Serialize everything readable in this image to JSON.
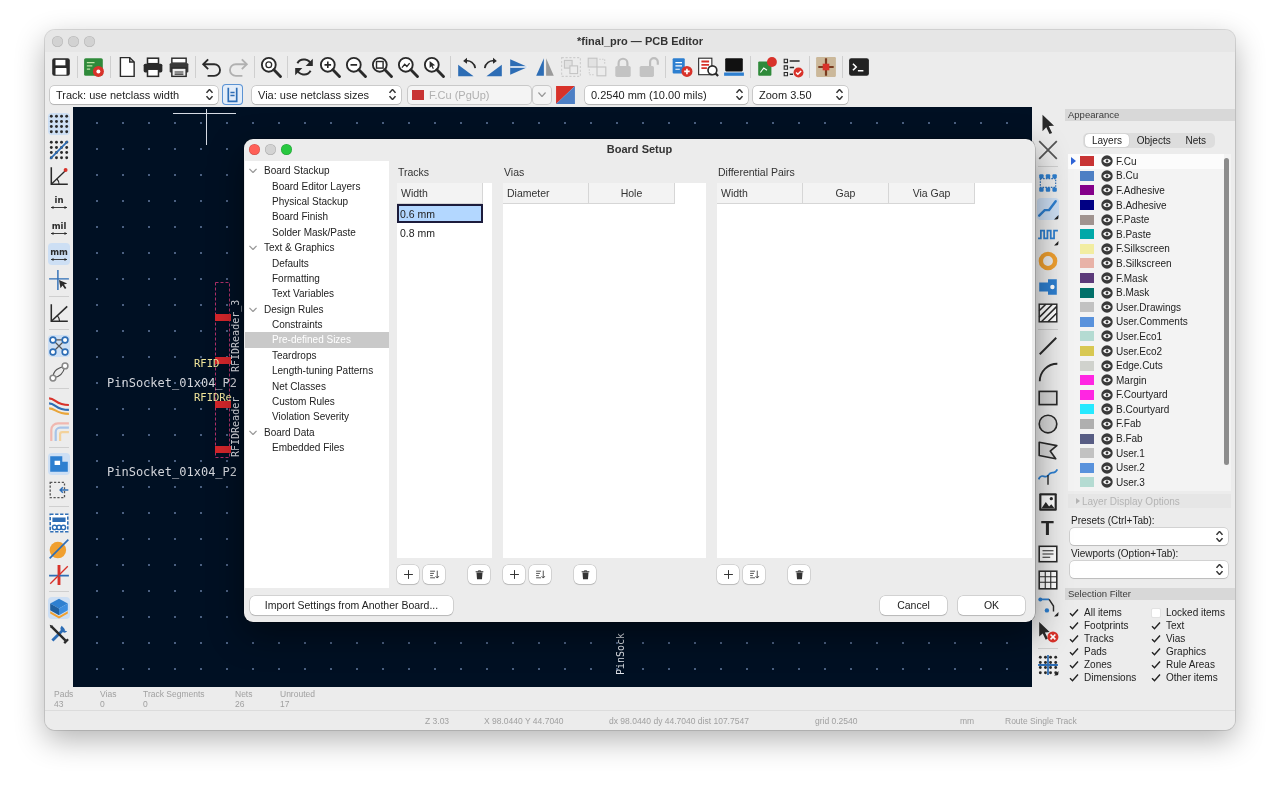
{
  "window": {
    "title": "*final_pro — PCB Editor"
  },
  "top_toolbar": [
    {
      "disabled": false
    },
    {
      "disabled": false
    },
    {
      "disabled": false
    },
    {
      "disabled": false
    },
    {
      "disabled": false
    },
    {
      "disabled": false
    },
    {
      "disabled": true
    },
    {
      "disabled": false
    },
    {
      "disabled": false
    },
    {
      "disabled": false
    },
    {
      "disabled": false
    },
    {
      "disabled": false
    },
    {
      "disabled": false
    },
    {
      "disabled": false
    },
    {
      "disabled": false
    },
    {
      "disabled": false
    },
    {
      "disabled": false
    },
    {
      "disabled": false
    },
    {
      "disabled": true
    },
    {
      "disabled": true
    },
    {
      "disabled": true
    },
    {
      "disabled": true
    },
    {
      "disabled": false
    },
    {
      "disabled": false
    },
    {
      "disabled": false
    },
    {
      "disabled": false
    },
    {
      "disabled": false
    },
    {
      "disabled": false
    },
    {
      "disabled": false
    }
  ],
  "options_bar": {
    "track_width": "Track: use netclass width",
    "width_toggle": {
      "on": true
    },
    "via_size": "Via: use netclass sizes",
    "layer": {
      "label": "F.Cu (PgUp)",
      "disabled": true
    },
    "grid": "0.2540 mm (10.00 mils)",
    "zoom": "Zoom 3.50"
  },
  "left_toolbar": [
    {
      "kind": "tool",
      "on": true
    },
    {
      "kind": "tool",
      "on": false
    },
    {
      "kind": "tool",
      "on": false
    },
    {
      "kind": "unit",
      "label": "in",
      "selected": false
    },
    {
      "kind": "unit",
      "label": "mil",
      "selected": false
    },
    {
      "kind": "unit",
      "label": "mm",
      "selected": true
    },
    {
      "kind": "tool",
      "on": false
    },
    {
      "kind": "tool",
      "on": false
    },
    {
      "kind": "tool",
      "on": true
    },
    {
      "kind": "tool",
      "on": false
    },
    {
      "kind": "tool",
      "on": false
    },
    {
      "kind": "tool",
      "on": false
    },
    {
      "kind": "tool",
      "on": true
    },
    {
      "kind": "tool",
      "on": false
    },
    {
      "kind": "tool",
      "on": false
    },
    {
      "kind": "tool",
      "on": false
    },
    {
      "kind": "tool",
      "on": false
    },
    {
      "kind": "tool",
      "on": true
    },
    {
      "kind": "tool",
      "on": false
    }
  ],
  "canvas": {
    "labels": [
      {
        "kind": "silk",
        "text": "RFID"
      },
      {
        "kind": "fab",
        "text": "PinSocket_01x04_P2"
      },
      {
        "kind": "silk",
        "text": "RFIDRe"
      },
      {
        "kind": "fab",
        "text": "PinSocket_01x04_P2"
      },
      {
        "kind": "rotated",
        "text": "RFIDReader_3"
      },
      {
        "kind": "rotated",
        "text": "RFIDReader"
      },
      {
        "kind": "rotated",
        "text": "PinSock"
      }
    ]
  },
  "right_toolbar": [
    {
      "kind": "tool",
      "on": false
    },
    {
      "kind": "tool",
      "on": false
    },
    {
      "kind": "tool",
      "on": false
    },
    {
      "kind": "tool",
      "on": true
    },
    {
      "kind": "tool",
      "on": false
    },
    {
      "kind": "tool",
      "on": false
    },
    {
      "kind": "tool",
      "on": false
    },
    {
      "kind": "tool",
      "on": false
    },
    {
      "kind": "tool",
      "on": false
    },
    {
      "kind": "tool",
      "on": false
    },
    {
      "kind": "tool",
      "on": false
    },
    {
      "kind": "tool",
      "on": false
    },
    {
      "kind": "tool",
      "on": false
    },
    {
      "kind": "tool",
      "on": false
    },
    {
      "kind": "tool",
      "on": false
    },
    {
      "kind": "glyph",
      "label": "T",
      "on": false
    },
    {
      "kind": "tool",
      "on": false
    },
    {
      "kind": "tool",
      "on": false
    },
    {
      "kind": "tool",
      "on": false
    },
    {
      "kind": "tool",
      "on": false
    },
    {
      "kind": "tool",
      "on": false
    }
  ],
  "appearance": {
    "title": "Appearance",
    "tabs": [
      {
        "label": "Layers",
        "selected": true
      },
      {
        "label": "Objects",
        "selected": false
      },
      {
        "label": "Nets",
        "selected": false
      }
    ],
    "layers": [
      {
        "name": "F.Cu",
        "color": "#c83434",
        "visible": true,
        "selected": true
      },
      {
        "name": "B.Cu",
        "color": "#4d7fc4",
        "visible": true,
        "selected": false
      },
      {
        "name": "F.Adhesive",
        "color": "#84008a",
        "visible": true,
        "selected": false
      },
      {
        "name": "B.Adhesive",
        "color": "#000084",
        "visible": true,
        "selected": false
      },
      {
        "name": "F.Paste",
        "color": "#a0938f",
        "visible": true,
        "selected": false
      },
      {
        "name": "B.Paste",
        "color": "#00a8a8",
        "visible": true,
        "selected": false
      },
      {
        "name": "F.Silkscreen",
        "color": "#f2eda1",
        "visible": true,
        "selected": false
      },
      {
        "name": "B.Silkscreen",
        "color": "#e8b2a7",
        "visible": true,
        "selected": false
      },
      {
        "name": "F.Mask",
        "color": "#5c3a7a",
        "visible": true,
        "selected": false
      },
      {
        "name": "B.Mask",
        "color": "#02706a",
        "visible": true,
        "selected": false
      },
      {
        "name": "User.Drawings",
        "color": "#c2c2c2",
        "visible": true,
        "selected": false
      },
      {
        "name": "User.Comments",
        "color": "#5992dc",
        "visible": true,
        "selected": false
      },
      {
        "name": "User.Eco1",
        "color": "#b4dbd2",
        "visible": true,
        "selected": false
      },
      {
        "name": "User.Eco2",
        "color": "#d8c852",
        "visible": true,
        "selected": false
      },
      {
        "name": "Edge.Cuts",
        "color": "#d0d2cd",
        "visible": true,
        "selected": false
      },
      {
        "name": "Margin",
        "color": "#ff26e2",
        "visible": true,
        "selected": false
      },
      {
        "name": "F.Courtyard",
        "color": "#ff26e2",
        "visible": true,
        "selected": false
      },
      {
        "name": "B.Courtyard",
        "color": "#26e9ff",
        "visible": true,
        "selected": false
      },
      {
        "name": "F.Fab",
        "color": "#afafaf",
        "visible": true,
        "selected": false
      },
      {
        "name": "B.Fab",
        "color": "#585d84",
        "visible": true,
        "selected": false
      },
      {
        "name": "User.1",
        "color": "#c2c2c2",
        "visible": true,
        "selected": false
      },
      {
        "name": "User.2",
        "color": "#5992dc",
        "visible": true,
        "selected": false
      },
      {
        "name": "User.3",
        "color": "#b4dbd2",
        "visible": true,
        "selected": false
      }
    ],
    "layer_display_options": "Layer Display Options",
    "presets_label": "Presets (Ctrl+Tab):",
    "viewports_label": "Viewports (Option+Tab):",
    "selection_filter": {
      "title": "Selection Filter",
      "items": [
        {
          "label": "All items",
          "checked": true
        },
        {
          "label": "Locked items",
          "checked": false
        },
        {
          "label": "Footprints",
          "checked": true
        },
        {
          "label": "Text",
          "checked": true
        },
        {
          "label": "Tracks",
          "checked": true
        },
        {
          "label": "Vias",
          "checked": true
        },
        {
          "label": "Pads",
          "checked": true
        },
        {
          "label": "Graphics",
          "checked": true
        },
        {
          "label": "Zones",
          "checked": true
        },
        {
          "label": "Rule Areas",
          "checked": true
        },
        {
          "label": "Dimensions",
          "checked": true
        },
        {
          "label": "Other items",
          "checked": true
        }
      ]
    }
  },
  "dialog": {
    "title": "Board Setup",
    "tree": [
      {
        "label": "Board Stackup",
        "expanded": true,
        "selected": false,
        "children": [
          {
            "label": "Board Editor Layers",
            "selected": false
          },
          {
            "label": "Physical Stackup",
            "selected": false
          },
          {
            "label": "Board Finish",
            "selected": false
          },
          {
            "label": "Solder Mask/Paste",
            "selected": false
          }
        ]
      },
      {
        "label": "Text & Graphics",
        "expanded": true,
        "selected": false,
        "children": [
          {
            "label": "Defaults",
            "selected": false
          },
          {
            "label": "Formatting",
            "selected": false
          },
          {
            "label": "Text Variables",
            "selected": false
          }
        ]
      },
      {
        "label": "Design Rules",
        "expanded": true,
        "selected": false,
        "children": [
          {
            "label": "Constraints",
            "selected": false
          },
          {
            "label": "Pre-defined Sizes",
            "selected": true
          },
          {
            "label": "Teardrops",
            "selected": false
          },
          {
            "label": "Length-tuning Patterns",
            "selected": false
          },
          {
            "label": "Net Classes",
            "selected": false
          },
          {
            "label": "Custom Rules",
            "selected": false
          },
          {
            "label": "Violation Severity",
            "selected": false
          }
        ]
      },
      {
        "label": "Board Data",
        "expanded": true,
        "selected": false,
        "children": [
          {
            "label": "Embedded Files",
            "selected": false
          }
        ]
      }
    ],
    "tracks": {
      "title": "Tracks",
      "columns": [
        "Width"
      ],
      "rows": [
        {
          "cells": [
            "0.6 mm"
          ],
          "selected": true
        },
        {
          "cells": [
            "0.8 mm"
          ],
          "selected": false
        }
      ]
    },
    "vias": {
      "title": "Vias",
      "columns": [
        "Diameter",
        "Hole"
      ]
    },
    "diff_pairs": {
      "title": "Differential Pairs",
      "columns": [
        "Width",
        "Gap",
        "Via Gap"
      ]
    },
    "import_button": "Import Settings from Another Board...",
    "buttons": [
      "Cancel",
      "OK"
    ]
  },
  "status_bar": {
    "counts": [
      {
        "label": "Pads",
        "value": "43"
      },
      {
        "label": "Vias",
        "value": "0"
      },
      {
        "label": "Track Segments",
        "value": "0"
      },
      {
        "label": "Nets",
        "value": "26"
      },
      {
        "label": "Unrouted",
        "value": "17"
      }
    ],
    "fields": [
      "Z 3.03",
      "X 98.0440  Y 44.7040",
      "dx 98.0440  dy 44.7040  dist 107.7547",
      "grid 0.2540",
      "mm",
      "Route Single Track"
    ]
  }
}
